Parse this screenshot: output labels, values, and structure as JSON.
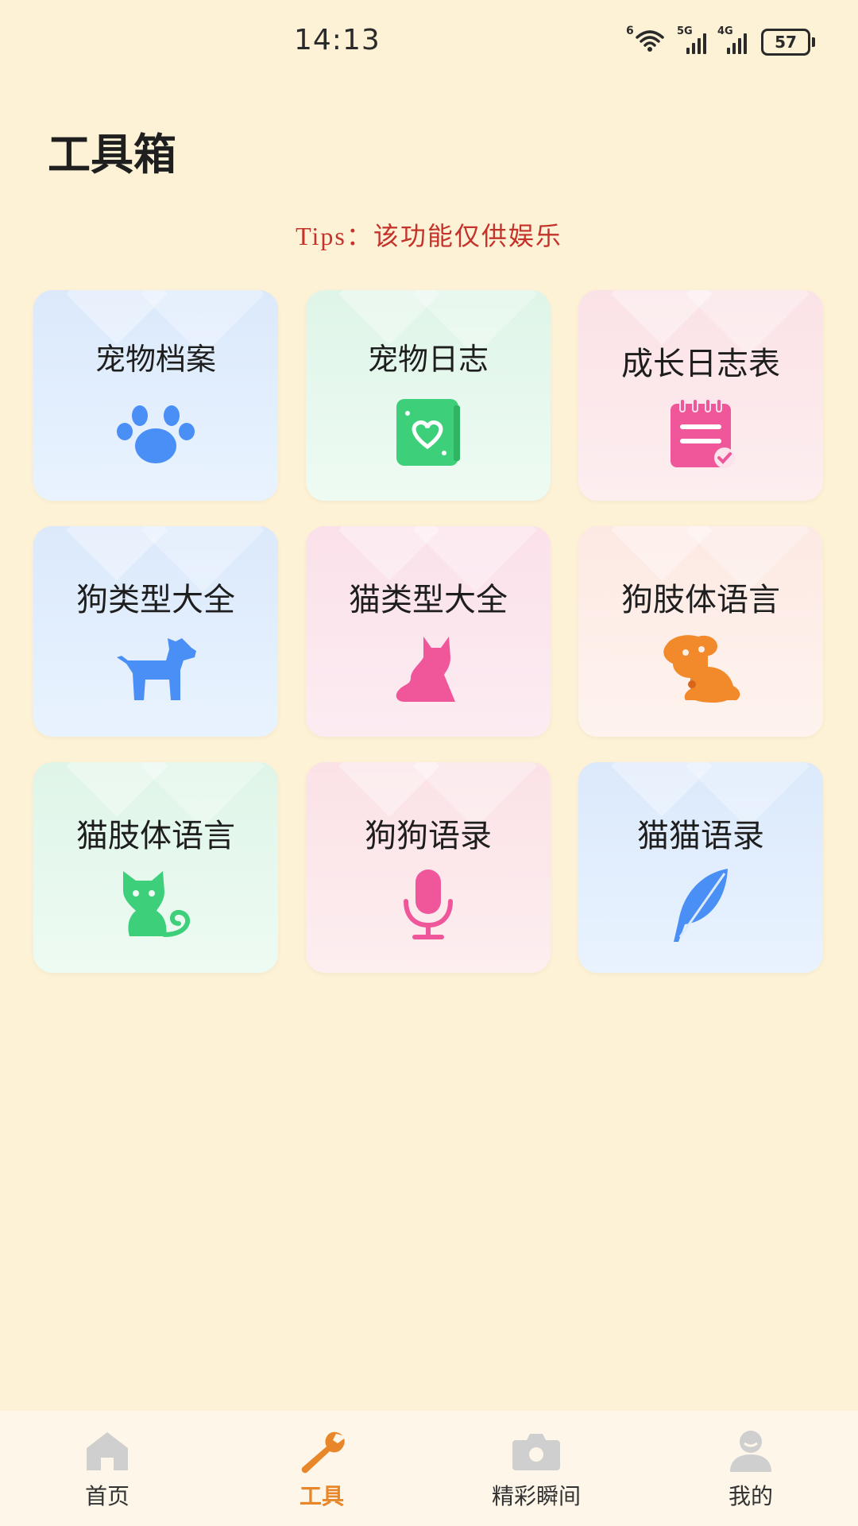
{
  "status": {
    "time": "14:13",
    "signal1_tag": "5G",
    "signal2_tag": "4G",
    "battery": "57",
    "wifi_tag": "6"
  },
  "page": {
    "title": "工具箱",
    "tips": "Tips：该功能仅供娱乐"
  },
  "tools": [
    {
      "label": "宠物档案",
      "icon": "paw-icon",
      "color": "#4a8ff5"
    },
    {
      "label": "宠物日志",
      "icon": "heart-book-icon",
      "color": "#3ecf7a"
    },
    {
      "label": "成长日志表",
      "icon": "notepad-icon",
      "color": "#f0569a"
    },
    {
      "label": "狗类型大全",
      "icon": "dog-icon",
      "color": "#4a8ff5"
    },
    {
      "label": "猫类型大全",
      "icon": "cat-icon",
      "color": "#f0569a"
    },
    {
      "label": "狗肢体语言",
      "icon": "puppy-icon",
      "color": "#f28a2c"
    },
    {
      "label": "猫肢体语言",
      "icon": "cat-tail-icon",
      "color": "#3ecf7a"
    },
    {
      "label": "狗狗语录",
      "icon": "microphone-icon",
      "color": "#f0569a"
    },
    {
      "label": "猫猫语录",
      "icon": "feather-icon",
      "color": "#4a8ff5"
    }
  ],
  "tabbar": {
    "home": "首页",
    "tools": "工具",
    "moments": "精彩瞬间",
    "mine": "我的",
    "active_color": "#e8872a",
    "inactive_icon_color": "#cfcfcf"
  }
}
